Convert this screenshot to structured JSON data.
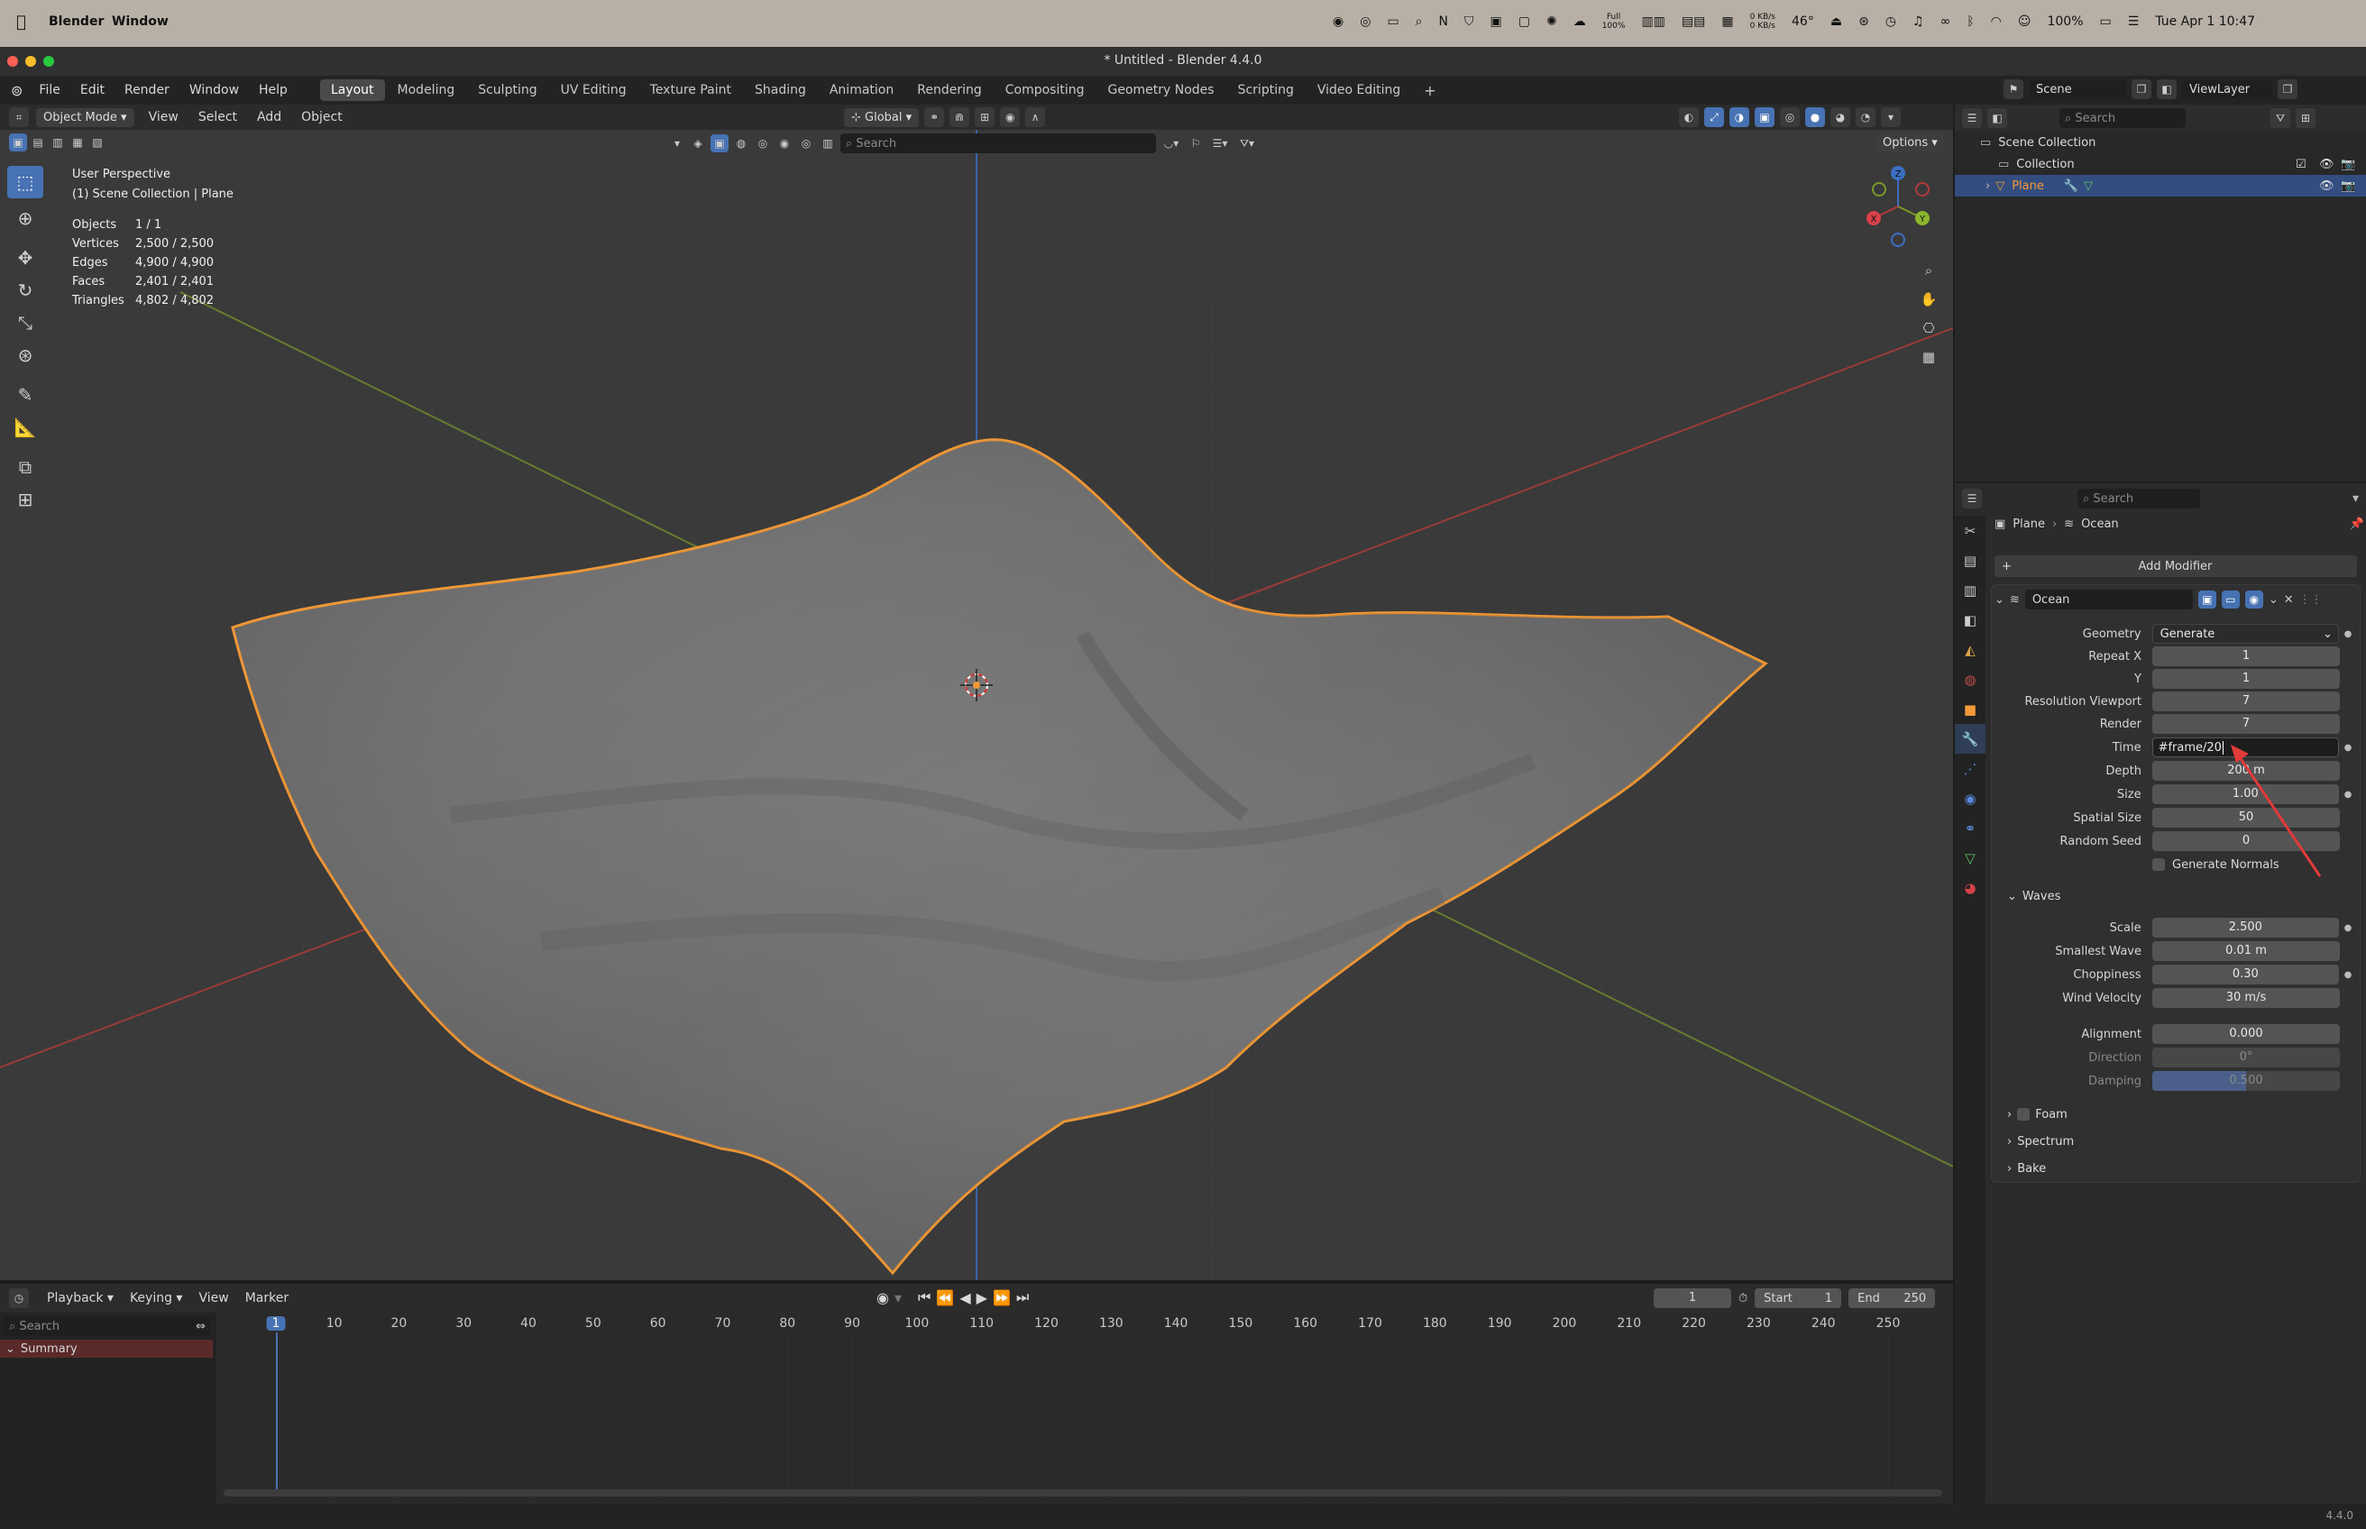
{
  "mac_menu": {
    "apple": "",
    "app": "Blender",
    "window": "Window",
    "battery": "100%",
    "datetime": "Tue Apr 1  10:47",
    "net_up": "0 KB/s",
    "net_down": "0 KB/s",
    "temp": "46°",
    "full_label": "Full",
    "full_pct": "100%"
  },
  "window": {
    "title": "* Untitled - Blender 4.4.0"
  },
  "menu": [
    "File",
    "Edit",
    "Render",
    "Window",
    "Help"
  ],
  "workspaces": [
    "Layout",
    "Modeling",
    "Sculpting",
    "UV Editing",
    "Texture Paint",
    "Shading",
    "Animation",
    "Rendering",
    "Compositing",
    "Geometry Nodes",
    "Scripting",
    "Video Editing"
  ],
  "scene": {
    "scene_name": "Scene",
    "view_layer": "ViewLayer"
  },
  "viewport_header": {
    "mode": "Object Mode",
    "menus": [
      "View",
      "Select",
      "Add",
      "Object"
    ],
    "orientation": "Global",
    "search_placeholder": "Search",
    "options": "Options"
  },
  "viewport": {
    "perspective": "User Perspective",
    "collection": "(1) Scene Collection | Plane",
    "stats": [
      {
        "k": "Objects",
        "v": "1 / 1"
      },
      {
        "k": "Vertices",
        "v": "2,500 / 2,500"
      },
      {
        "k": "Edges",
        "v": "4,900 / 4,900"
      },
      {
        "k": "Faces",
        "v": "2,401 / 2,401"
      },
      {
        "k": "Triangles",
        "v": "4,802 / 4,802"
      }
    ],
    "gizmo": {
      "x": "X",
      "y": "Y",
      "z": "Z"
    }
  },
  "outliner": {
    "search_placeholder": "Search",
    "items": [
      "Scene Collection",
      "Collection",
      "Plane"
    ]
  },
  "properties": {
    "search_placeholder": "Search",
    "breadcrumb": [
      "Plane",
      "Ocean"
    ],
    "add_modifier": "Add Modifier",
    "modifier_name": "Ocean",
    "fields": {
      "geometry": {
        "label": "Geometry",
        "value": "Generate"
      },
      "repeat_x": {
        "label": "Repeat X",
        "value": "1"
      },
      "repeat_y": {
        "label": "Y",
        "value": "1"
      },
      "res_viewport": {
        "label": "Resolution Viewport",
        "value": "7"
      },
      "res_render": {
        "label": "Render",
        "value": "7"
      },
      "time": {
        "label": "Time",
        "value": "#frame/20"
      },
      "depth": {
        "label": "Depth",
        "value": "200 m"
      },
      "size": {
        "label": "Size",
        "value": "1.00"
      },
      "spatial_size": {
        "label": "Spatial Size",
        "value": "50"
      },
      "random_seed": {
        "label": "Random Seed",
        "value": "0"
      },
      "generate_normals": "Generate Normals"
    },
    "waves": {
      "title": "Waves",
      "scale": {
        "label": "Scale",
        "value": "2.500"
      },
      "smallest_wave": {
        "label": "Smallest Wave",
        "value": "0.01 m"
      },
      "choppiness": {
        "label": "Choppiness",
        "value": "0.30"
      },
      "wind_velocity": {
        "label": "Wind Velocity",
        "value": "30 m/s"
      },
      "alignment": {
        "label": "Alignment",
        "value": "0.000"
      },
      "direction": {
        "label": "Direction",
        "value": "0°"
      },
      "damping": {
        "label": "Damping",
        "value": "0.500"
      }
    },
    "panels": [
      "Foam",
      "Spectrum",
      "Bake"
    ]
  },
  "timeline": {
    "menus": [
      "Playback",
      "Keying",
      "View",
      "Marker"
    ],
    "current_frame": "1",
    "start_label": "Start",
    "start": "1",
    "end_label": "End",
    "end": "250",
    "search_placeholder": "Search",
    "summary": "Summary",
    "ticks": [
      "1",
      "10",
      "20",
      "30",
      "40",
      "50",
      "60",
      "70",
      "80",
      "90",
      "100",
      "110",
      "120",
      "130",
      "140",
      "150",
      "160",
      "170",
      "180",
      "190",
      "200",
      "210",
      "220",
      "230",
      "240",
      "250"
    ]
  },
  "status": {
    "version": "4.4.0"
  },
  "colors": {
    "accent": "#4772b3",
    "selection_outline": "#f29a38",
    "active_row": "#334d80"
  }
}
